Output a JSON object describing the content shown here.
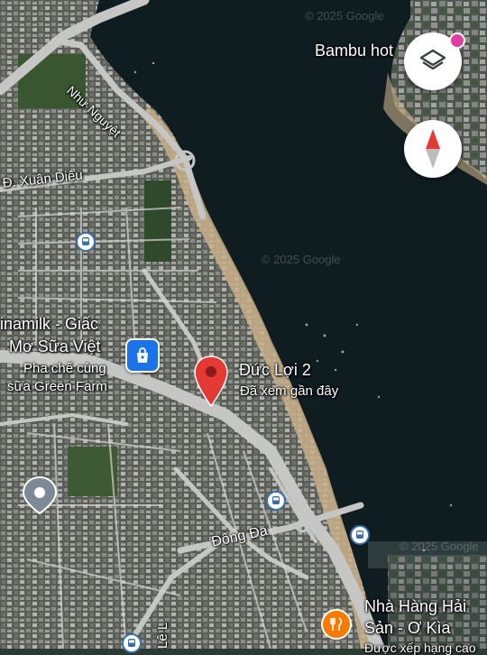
{
  "map": {
    "watermark": "© 2025 Google",
    "watermark_secondary": "© 2025 Google",
    "watermark_tertiary": "© 2025 Google",
    "labels": {
      "bambu": "Bambu hot",
      "nhu_nguyet": "Như Nguyệt",
      "xuan_dieu": "Đ. Xuân Diệu",
      "vinamilk_line1": "inamilk - Giấc",
      "vinamilk_line2": "Mơ Sữa Việt",
      "vinamilk_sub1": "Pha chế cùng",
      "vinamilk_sub2": "sữa Green Farm",
      "dong_da": "Đống Đa",
      "le": "Lê L",
      "restaurant_line1": "Nhà Hàng Hải",
      "restaurant_line2": "Sản - Ơ Kìa",
      "restaurant_sub": "Được xếp hạng cao"
    },
    "pin": {
      "name": "Đức Lợi 2",
      "status": "Đã xem gần đây"
    }
  },
  "controls": {
    "layers_icon": "layers-icon",
    "compass_icon": "compass-icon"
  },
  "colors": {
    "water": "#0f1c20",
    "pin": "#e53935",
    "shopping": "#1a73e8",
    "restaurant": "#f57c00",
    "bus": "#3b6fa8"
  }
}
